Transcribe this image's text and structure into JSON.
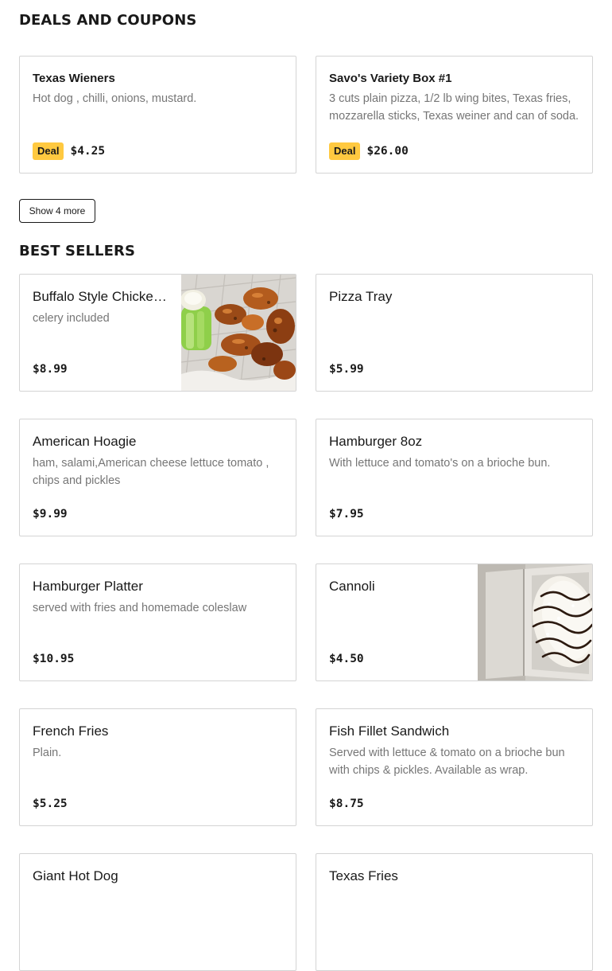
{
  "deals": {
    "title": "DEALS AND COUPONS",
    "items": [
      {
        "name": "Texas Wieners",
        "description": "Hot dog , chilli, onions, mustard.",
        "badge": "Deal",
        "price": "$4.25"
      },
      {
        "name": "Savo's Variety Box #1",
        "description": "3 cuts plain pizza, 1/2 lb wing bites, Texas fries, mozzarella sticks, Texas weiner and can of soda.",
        "badge": "Deal",
        "price": "$26.00"
      }
    ],
    "show_more_label": "Show 4 more"
  },
  "best_sellers": {
    "title": "BEST SELLERS",
    "items": [
      {
        "name": "Buffalo Style Chicken Wings",
        "description": "celery included",
        "price": "$8.99",
        "image": "chicken-wings-photo"
      },
      {
        "name": "Pizza Tray",
        "description": "",
        "price": "$5.99"
      },
      {
        "name": "American Hoagie",
        "description": "ham, salami,American cheese lettuce tomato , chips and pickles",
        "price": "$9.99"
      },
      {
        "name": "Hamburger 8oz",
        "description": "With lettuce and tomato's on a brioche bun.",
        "price": "$7.95"
      },
      {
        "name": "Hamburger Platter",
        "description": "served with fries and homemade coleslaw",
        "price": "$10.95"
      },
      {
        "name": "Cannoli",
        "description": "",
        "price": "$4.50",
        "image": "cannoli-photo"
      },
      {
        "name": "French Fries",
        "description": "Plain.",
        "price": "$5.25"
      },
      {
        "name": "Fish Fillet Sandwich",
        "description": "Served with lettuce & tomato on a brioche bun with chips & pickles. Available as wrap.",
        "price": "$8.75"
      },
      {
        "name": "Giant Hot Dog",
        "description": "",
        "price": ""
      },
      {
        "name": "Texas Fries",
        "description": "",
        "price": ""
      }
    ]
  }
}
